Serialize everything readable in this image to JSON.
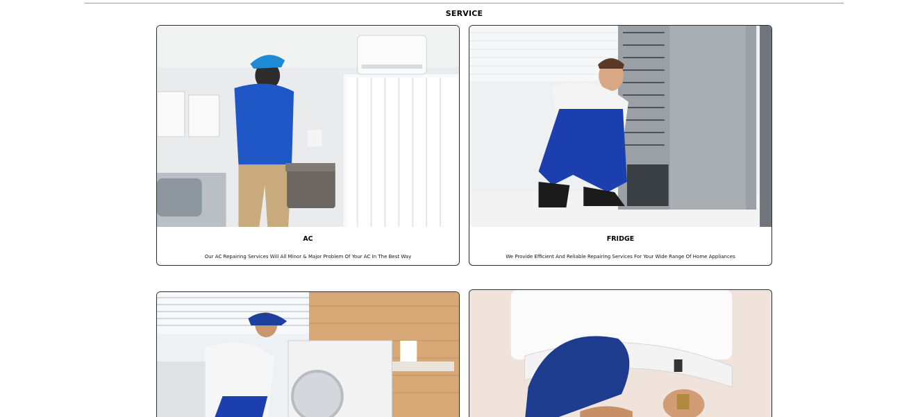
{
  "section": {
    "title": "SERVICE"
  },
  "cards": [
    {
      "title": "AC",
      "description": "Our AC Repairing Services Will All Minor & Major Problem Of Your AC In The Best Way",
      "image_icon": "ac-technician-photo"
    },
    {
      "title": "FRIDGE",
      "description": "We Provide Efficient And Reliable Repairing Services For Your Wide Range Of Home Appliances",
      "image_icon": "fridge-technician-photo"
    },
    {
      "image_icon": "washing-machine-technician-photo"
    },
    {
      "image_icon": "geyser-technician-photo"
    }
  ],
  "colors": {
    "border": "#2b2b2b",
    "rule": "#9a9a9a",
    "uniform_blue": "#1f4fb3"
  }
}
